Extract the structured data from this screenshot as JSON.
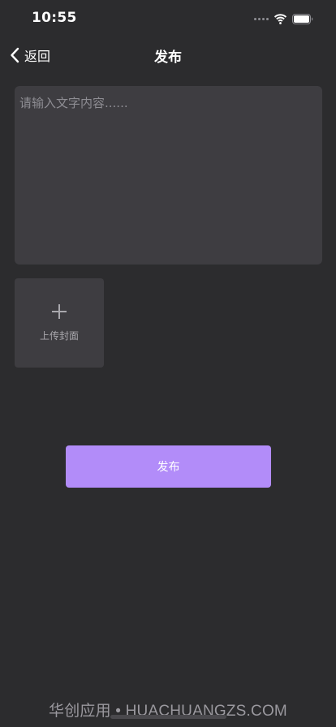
{
  "status_bar": {
    "time": "10:55",
    "icons": [
      "signal-icon",
      "wifi-icon",
      "battery-icon"
    ]
  },
  "nav": {
    "back_label": "返回",
    "title": "发布",
    "back_icon": "chevron-left-icon"
  },
  "form": {
    "content_placeholder": "请输入文字内容......",
    "content_value": "",
    "upload_label": "上传封面",
    "upload_icon": "plus-icon"
  },
  "actions": {
    "publish_label": "发布"
  },
  "watermark": {
    "text": "华创应用 • HUACHUANGZS.COM"
  },
  "colors": {
    "background": "#2c2c2e",
    "field_background": "#3e3d41",
    "accent": "#b28cf9",
    "placeholder": "#8e8d93"
  }
}
